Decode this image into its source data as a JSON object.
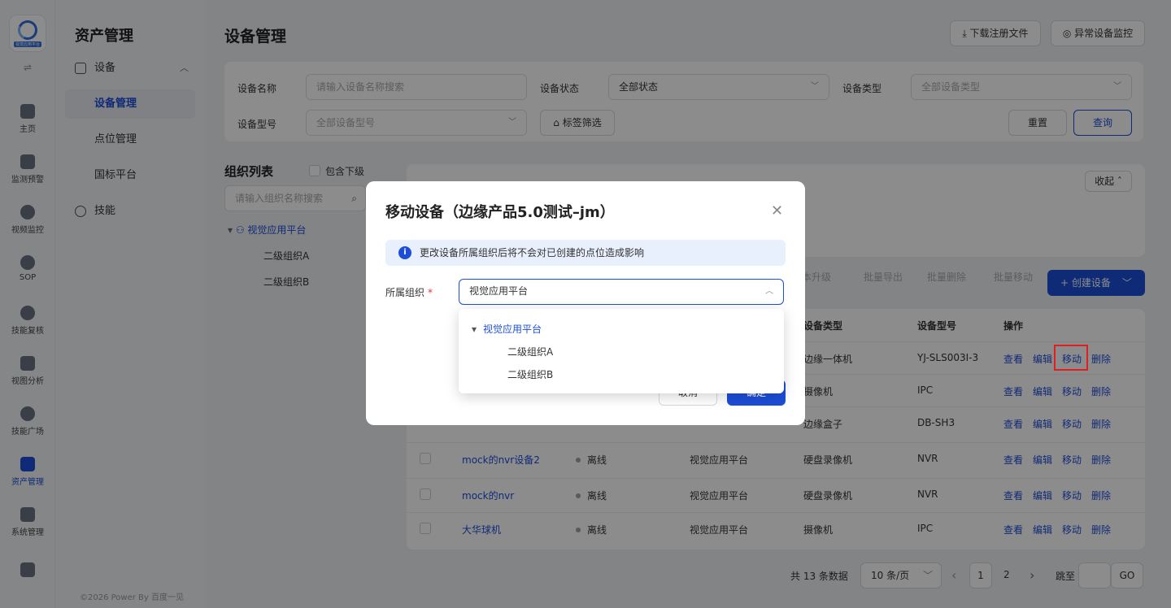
{
  "rail": {
    "logo_text": "视觉应用平台",
    "switch_glyph": "⇌",
    "items": [
      {
        "label": "主页",
        "icon": "home-icon"
      },
      {
        "label": "监测预警",
        "icon": "chart-icon"
      },
      {
        "label": "视频监控",
        "icon": "camera-icon"
      },
      {
        "label": "SOP",
        "icon": "sop-icon"
      },
      {
        "label": "技能复核",
        "icon": "review-icon"
      },
      {
        "label": "视图分析",
        "icon": "analysis-icon"
      },
      {
        "label": "技能广场",
        "icon": "plaza-icon"
      },
      {
        "label": "资产管理",
        "icon": "asset-icon"
      },
      {
        "label": "系统管理",
        "icon": "system-icon"
      }
    ]
  },
  "sidebar": {
    "title": "资产管理",
    "group": "设备",
    "items": [
      "设备管理",
      "点位管理",
      "国标平台"
    ],
    "skills": "技能",
    "copyright": "©2026 Power By 百度一见"
  },
  "header": {
    "title": "设备管理",
    "download_btn": "下载注册文件",
    "monitor_btn": "异常设备监控"
  },
  "filters": {
    "name_label": "设备名称",
    "name_placeholder": "请输入设备名称搜索",
    "status_label": "设备状态",
    "status_value": "全部状态",
    "type_label": "设备类型",
    "type_placeholder": "全部设备类型",
    "model_label": "设备型号",
    "model_placeholder": "全部设备型号",
    "tag_btn": "标签筛选",
    "reset_btn": "重置",
    "query_btn": "查询"
  },
  "org_panel": {
    "title": "组织列表",
    "include_sub": "包含下级",
    "search_placeholder": "请输入组织名称搜索",
    "root": "视觉应用平台",
    "children": [
      "二级组织A",
      "二级组织B"
    ]
  },
  "stats": {
    "collapse_btn": "收起"
  },
  "toolbar": {
    "batch_upgrade": "本升级",
    "batch_export": "批量导出",
    "batch_delete": "批量删除",
    "batch_move": "批量移动",
    "create_btn": "+ 创建设备"
  },
  "table": {
    "headers": {
      "type": "设备类型",
      "model": "设备型号",
      "ops": "操作"
    },
    "ops": {
      "view": "查看",
      "edit": "编辑",
      "move": "移动",
      "delete": "删除"
    },
    "rows": [
      {
        "name": "",
        "status": "",
        "org": "",
        "type": "边缘一体机",
        "model": "YJ-SLS003I-3"
      },
      {
        "name": "",
        "status": "",
        "org": "",
        "type": "摄像机",
        "model": "IPC"
      },
      {
        "name": "",
        "status": "",
        "org": "",
        "type": "边缘盒子",
        "model": "DB-SH3"
      },
      {
        "name": "mock的nvr设备2",
        "status": "离线",
        "org": "视觉应用平台",
        "type": "硬盘录像机",
        "model": "NVR"
      },
      {
        "name": "mock的nvr",
        "status": "离线",
        "org": "视觉应用平台",
        "type": "硬盘录像机",
        "model": "NVR"
      },
      {
        "name": "大华球机",
        "status": "离线",
        "org": "视觉应用平台",
        "type": "摄像机",
        "model": "IPC"
      }
    ]
  },
  "pager": {
    "total": "共 13 条数据",
    "page_size": "10 条/页",
    "prev": "‹",
    "page1": "1",
    "page2": "2",
    "next": "›",
    "jump_label": "跳至",
    "go_btn": "GO"
  },
  "modal": {
    "title": "移动设备（边缘产品5.0测试–jm）",
    "notice": "更改设备所属组织后将不会对已创建的点位造成影响",
    "org_label": "所属组织",
    "org_value": "视觉应用平台",
    "cancel_btn": "取消",
    "ok_btn": "确定",
    "dropdown": {
      "root": "视觉应用平台",
      "children": [
        "二级组织A",
        "二级组织B"
      ]
    }
  }
}
